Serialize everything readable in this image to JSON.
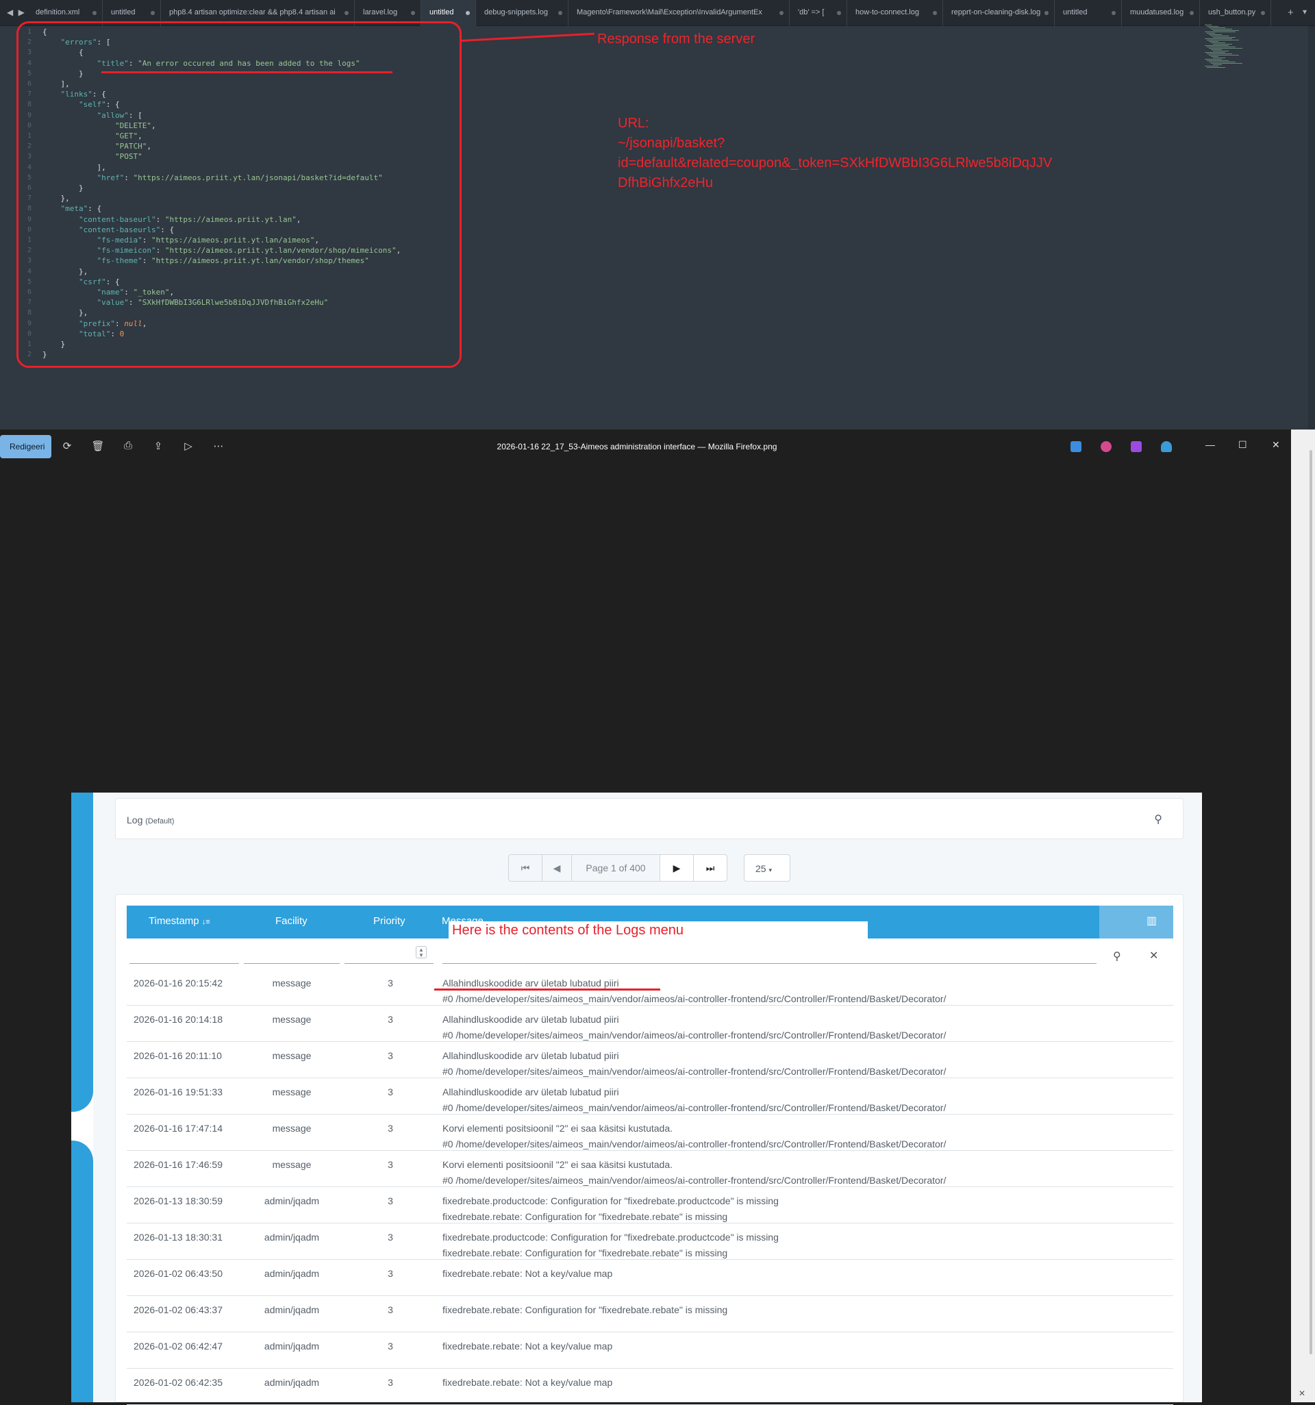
{
  "editor": {
    "tabs": [
      {
        "label": "definition.xml",
        "left": 0,
        "width": 0
      },
      {
        "label": "untitled"
      },
      {
        "label": "php8.4 artisan optimize:clear && php8.4 artisan ai"
      },
      {
        "label": "laravel.log"
      },
      {
        "label": "untitled",
        "active": true
      },
      {
        "label": "debug-snippets.log"
      },
      {
        "label": "Magento\\Framework\\Mail\\Exception\\InvalidArgumentEx"
      },
      {
        "label": "'db' => ["
      },
      {
        "label": "how-to-connect.log"
      },
      {
        "label": "repprt-on-cleaning-disk.log"
      },
      {
        "label": "untitled"
      },
      {
        "label": "muudatused.log"
      },
      {
        "label": "ush_button.py"
      }
    ],
    "line_numbers": [
      "1",
      "2",
      "3",
      "4",
      "5",
      "6",
      "7",
      "8",
      "9",
      "0",
      "1",
      "2",
      "3",
      "4",
      "5",
      "6",
      "7",
      "8",
      "9",
      "0",
      "1",
      "2",
      "3",
      "4",
      "5",
      "6",
      "7",
      "8",
      "9",
      "0",
      "1",
      "2"
    ],
    "json_lines": [
      "{",
      "    \"errors\": [",
      "        {",
      "            \"title\": \"An error occured and has been added to the logs\"",
      "        }",
      "    ],",
      "    \"links\": {",
      "        \"self\": {",
      "            \"allow\": [",
      "                \"DELETE\",",
      "                \"GET\",",
      "                \"PATCH\",",
      "                \"POST\"",
      "            ],",
      "            \"href\": \"https://aimeos.priit.yt.lan/jsonapi/basket?id=default\"",
      "        }",
      "    },",
      "    \"meta\": {",
      "        \"content-baseurl\": \"https://aimeos.priit.yt.lan\",",
      "        \"content-baseurls\": {",
      "            \"fs-media\": \"https://aimeos.priit.yt.lan/aimeos\",",
      "            \"fs-mimeicon\": \"https://aimeos.priit.yt.lan/vendor/shop/mimeicons\",",
      "            \"fs-theme\": \"https://aimeos.priit.yt.lan/vendor/shop/themes\"",
      "        },",
      "        \"csrf\": {",
      "            \"name\": \"_token\",",
      "            \"value\": \"SXkHfDWBbI3G6LRlwe5b8iDqJJVDfhBiGhfx2eHu\"",
      "        },",
      "        \"prefix\": null,",
      "        \"total\": 0",
      "    }",
      "}"
    ],
    "annotations": {
      "response": "Response from the server",
      "url_lines": [
        "URL:",
        "~/jsonapi/basket?",
        "id=default&related=coupon&_token=SXkHfDWBbI3G6LRlwe5b8iDqJJV",
        "DfhBiGhfx2eHu"
      ]
    }
  },
  "viewer": {
    "edit_label": "Redigeeri",
    "title": "2026-01-16 22_17_53-Aimeos administration interface — Mozilla Firefox.png"
  },
  "admin": {
    "search_title": "Log",
    "search_sub": "(Default)",
    "pager": {
      "page_text": "Page 1 of 400",
      "per_page": "25"
    },
    "columns": {
      "timestamp": "Timestamp",
      "facility": "Facility",
      "priority": "Priority",
      "message": "Message"
    },
    "annotation": "Here is the contents of the Logs menu",
    "rows": [
      {
        "ts": "2026-01-16 20:15:42",
        "facility": "message",
        "priority": "3",
        "msg1": "Allahindluskoodide arv ületab lubatud piiri",
        "msg2": "#0 /home/developer/sites/aimeos_main/vendor/aimeos/ai-controller-frontend/src/Controller/Frontend/Basket/Decorator/"
      },
      {
        "ts": "2026-01-16 20:14:18",
        "facility": "message",
        "priority": "3",
        "msg1": "Allahindluskoodide arv ületab lubatud piiri",
        "msg2": "#0 /home/developer/sites/aimeos_main/vendor/aimeos/ai-controller-frontend/src/Controller/Frontend/Basket/Decorator/"
      },
      {
        "ts": "2026-01-16 20:11:10",
        "facility": "message",
        "priority": "3",
        "msg1": "Allahindluskoodide arv ületab lubatud piiri",
        "msg2": "#0 /home/developer/sites/aimeos_main/vendor/aimeos/ai-controller-frontend/src/Controller/Frontend/Basket/Decorator/"
      },
      {
        "ts": "2026-01-16 19:51:33",
        "facility": "message",
        "priority": "3",
        "msg1": "Allahindluskoodide arv ületab lubatud piiri",
        "msg2": "#0 /home/developer/sites/aimeos_main/vendor/aimeos/ai-controller-frontend/src/Controller/Frontend/Basket/Decorator/"
      },
      {
        "ts": "2026-01-16 17:47:14",
        "facility": "message",
        "priority": "3",
        "msg1": "Korvi elementi positsioonil \"2\" ei saa käsitsi kustutada.",
        "msg2": "#0 /home/developer/sites/aimeos_main/vendor/aimeos/ai-controller-frontend/src/Controller/Frontend/Basket/Decorator/"
      },
      {
        "ts": "2026-01-16 17:46:59",
        "facility": "message",
        "priority": "3",
        "msg1": "Korvi elementi positsioonil \"2\" ei saa käsitsi kustutada.",
        "msg2": "#0 /home/developer/sites/aimeos_main/vendor/aimeos/ai-controller-frontend/src/Controller/Frontend/Basket/Decorator/"
      },
      {
        "ts": "2026-01-13 18:30:59",
        "facility": "admin/jqadm",
        "priority": "3",
        "msg1": "fixedrebate.productcode: Configuration for \"fixedrebate.productcode\" is missing",
        "msg2": "fixedrebate.rebate: Configuration for \"fixedrebate.rebate\" is missing"
      },
      {
        "ts": "2026-01-13 18:30:31",
        "facility": "admin/jqadm",
        "priority": "3",
        "msg1": "fixedrebate.productcode: Configuration for \"fixedrebate.productcode\" is missing",
        "msg2": "fixedrebate.rebate: Configuration for \"fixedrebate.rebate\" is missing"
      },
      {
        "ts": "2026-01-02 06:43:50",
        "facility": "admin/jqadm",
        "priority": "3",
        "msg1": "fixedrebate.rebate: Not a key/value map",
        "msg2": ""
      },
      {
        "ts": "2026-01-02 06:43:37",
        "facility": "admin/jqadm",
        "priority": "3",
        "msg1": "fixedrebate.rebate: Configuration for \"fixedrebate.rebate\" is missing",
        "msg2": ""
      },
      {
        "ts": "2026-01-02 06:42:47",
        "facility": "admin/jqadm",
        "priority": "3",
        "msg1": "fixedrebate.rebate: Not a key/value map",
        "msg2": ""
      },
      {
        "ts": "2026-01-02 06:42:35",
        "facility": "admin/jqadm",
        "priority": "3",
        "msg1": "fixedrebate.rebate: Not a key/value map",
        "msg2": ""
      }
    ]
  },
  "colors": {
    "accent": "#2ea0dc",
    "annotation": "#e8202a",
    "editor_bg": "#303841"
  }
}
